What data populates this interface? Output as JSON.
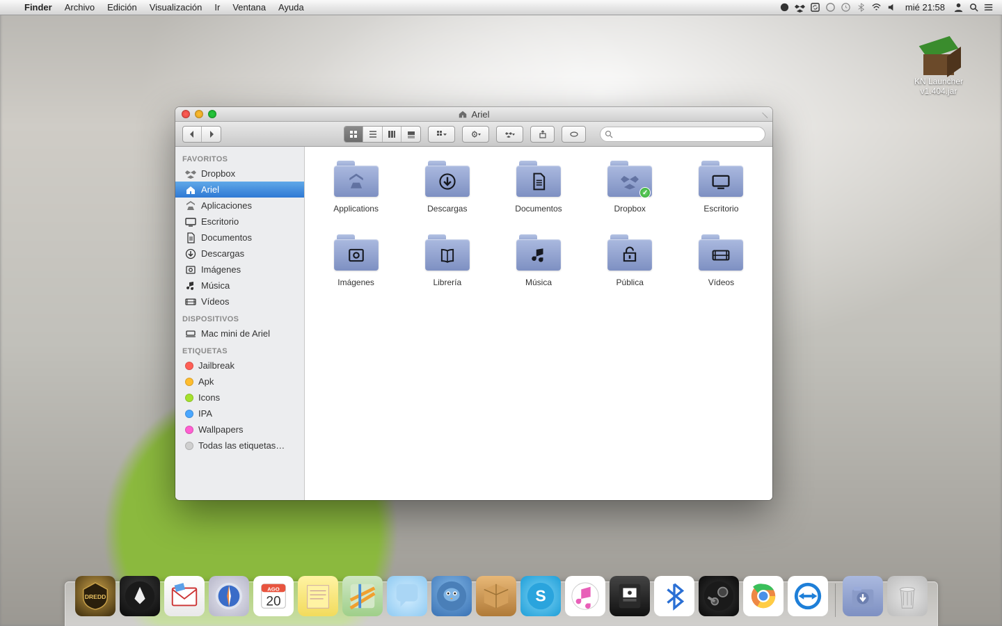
{
  "menubar": {
    "app": "Finder",
    "items": [
      "Archivo",
      "Edición",
      "Visualización",
      "Ir",
      "Ventana",
      "Ayuda"
    ],
    "clock": "mié 21:58"
  },
  "desktop": {
    "icon_label": "KN Launcher v1.404.jar"
  },
  "finder": {
    "title": "Ariel",
    "search_placeholder": "",
    "sidebar": {
      "favorites_header": "FAVORITOS",
      "favorites": [
        {
          "label": "Dropbox",
          "icon": "dropbox"
        },
        {
          "label": "Ariel",
          "icon": "home",
          "selected": true
        },
        {
          "label": "Aplicaciones",
          "icon": "apps"
        },
        {
          "label": "Escritorio",
          "icon": "desktop"
        },
        {
          "label": "Documentos",
          "icon": "docs"
        },
        {
          "label": "Descargas",
          "icon": "downloads"
        },
        {
          "label": "Imágenes",
          "icon": "images"
        },
        {
          "label": "Música",
          "icon": "music"
        },
        {
          "label": "Vídeos",
          "icon": "videos"
        }
      ],
      "devices_header": "DISPOSITIVOS",
      "devices": [
        {
          "label": "Mac mini de Ariel",
          "icon": "mac"
        }
      ],
      "tags_header": "ETIQUETAS",
      "tags": [
        {
          "label": "Jailbreak",
          "color": "#ff5f56"
        },
        {
          "label": "Apk",
          "color": "#ffbd2e"
        },
        {
          "label": "Icons",
          "color": "#a5e12d"
        },
        {
          "label": "IPA",
          "color": "#4aa7ff"
        },
        {
          "label": "Wallpapers",
          "color": "#ff5fd1"
        },
        {
          "label": "Todas las etiquetas…",
          "color": "#cfcfcf"
        }
      ]
    },
    "folders": [
      {
        "label": "Applications",
        "glyph": "apps"
      },
      {
        "label": "Descargas",
        "glyph": "downloads"
      },
      {
        "label": "Documentos",
        "glyph": "docs"
      },
      {
        "label": "Dropbox",
        "glyph": "dropbox",
        "badge": true
      },
      {
        "label": "Escritorio",
        "glyph": "desktop"
      },
      {
        "label": "Imágenes",
        "glyph": "images"
      },
      {
        "label": "Librería",
        "glyph": "library"
      },
      {
        "label": "Música",
        "glyph": "music"
      },
      {
        "label": "Pública",
        "glyph": "public"
      },
      {
        "label": "Vídeos",
        "glyph": "videos"
      }
    ]
  },
  "dock": {
    "apps": [
      {
        "name": "dredd",
        "class": "t-dredd"
      },
      {
        "name": "launchpad",
        "class": "t-launch"
      },
      {
        "name": "mail",
        "class": "t-mail"
      },
      {
        "name": "safari",
        "class": "t-safari"
      },
      {
        "name": "calendar",
        "class": "t-cal"
      },
      {
        "name": "notes",
        "class": "t-notes"
      },
      {
        "name": "maps",
        "class": "t-maps"
      },
      {
        "name": "messages",
        "class": "t-msg"
      },
      {
        "name": "tweetbot",
        "class": "t-tweet"
      },
      {
        "name": "package",
        "class": "t-box"
      },
      {
        "name": "skype",
        "class": "t-skype"
      },
      {
        "name": "itunes",
        "class": "t-itunes"
      },
      {
        "name": "devcenter",
        "class": "t-dev"
      },
      {
        "name": "bluetooth",
        "class": "t-bt"
      },
      {
        "name": "steam",
        "class": "t-steam"
      },
      {
        "name": "chrome",
        "class": "t-chrome"
      },
      {
        "name": "teamviewer",
        "class": "t-tv"
      }
    ],
    "right": [
      {
        "name": "downloads-stack",
        "class": "t-dl"
      },
      {
        "name": "trash",
        "class": "t-trash"
      }
    ],
    "cal_month": "AGO",
    "cal_day": "20"
  }
}
